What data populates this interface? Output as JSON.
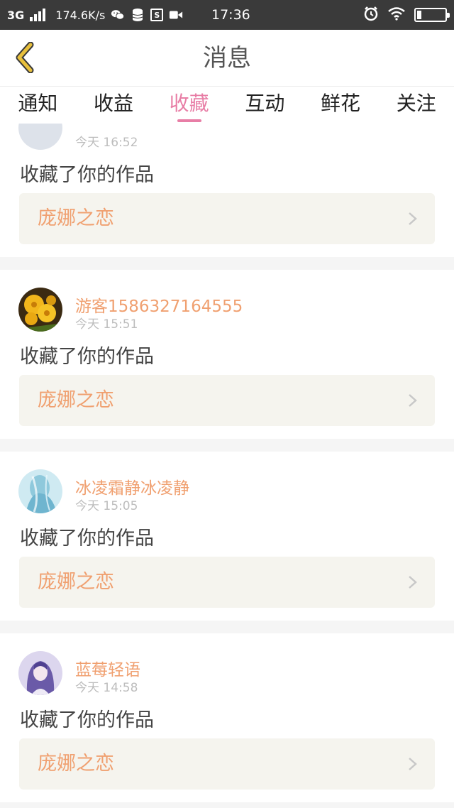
{
  "statusbar": {
    "network": "3G",
    "speed": "174.6K/s",
    "time": "17:36",
    "icons": [
      "signal-icon",
      "wechat-icon",
      "database-icon",
      "s-box-icon",
      "video-icon",
      "alarm-icon",
      "wifi-icon",
      "battery-icon"
    ]
  },
  "header": {
    "title": "消息",
    "back_icon": "chevron-left-icon",
    "accent": "#e8c03c"
  },
  "tabs": [
    {
      "label": "通知"
    },
    {
      "label": "收益"
    },
    {
      "label": "收藏",
      "active": true
    },
    {
      "label": "互动"
    },
    {
      "label": "鲜花"
    },
    {
      "label": "关注"
    }
  ],
  "colors": {
    "active_tab": "#e87ea6",
    "username": "#f0a070",
    "work_title": "#f0a070",
    "timestamp": "#bdbdbd"
  },
  "partial_card": {
    "time": "今天 16:52",
    "action": "收藏了你的作品",
    "work_title": "庞娜之恋"
  },
  "cards": [
    {
      "name": "游客1586327164555",
      "time": "今天 15:51",
      "action": "收藏了你的作品",
      "work_title": "庞娜之恋"
    },
    {
      "name": "冰凌霜静冰凌静",
      "time": "今天 15:05",
      "action": "收藏了你的作品",
      "work_title": "庞娜之恋"
    },
    {
      "name": "蓝莓轻语",
      "time": "今天 14:58",
      "action": "收藏了你的作品",
      "work_title": "庞娜之恋"
    }
  ]
}
